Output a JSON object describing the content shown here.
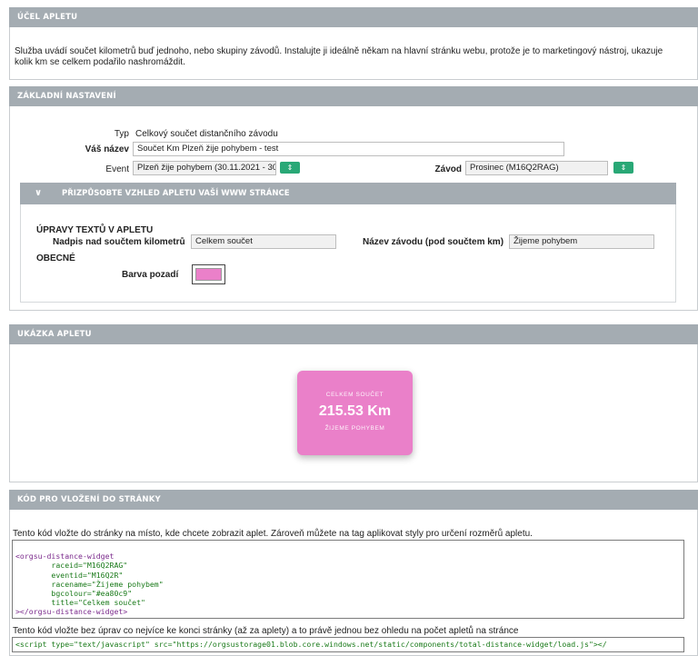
{
  "sections": {
    "ucel": {
      "title": "Účel apletu",
      "description_line1": "Služba uvádí součet kilometrů buď jednoho, nebo skupiny závodů. Instalujte ji ideálně někam na hlavní stránku webu, protože je to marketingový nástroj, ukazuje",
      "description_line2": "kolik km se celkem podařilo nashromáždit."
    },
    "zakladni": {
      "title": "Základní nastavení",
      "typ_label": "Typ",
      "typ_value": "Celkový součet distančního závodu",
      "nazev_label": "Váš název",
      "nazev_value": "Součet Km Plzeň žije pohybem - test",
      "event_label": "Event",
      "event_value": "Plzeň žije pohybem (30.11.2021 - 30.",
      "zavod_label": "Závod",
      "zavod_value": "Prosinec (M16Q2RAG)",
      "customize": {
        "title": "Přizpůsobte vzhled apletu vaší www stránce",
        "texts_heading": "Úpravy textů v apletu",
        "nadpis_label": "Nadpis nad součtem kilometrů",
        "nadpis_value": "Celkem součet",
        "nazev_zavodu_label": "Název závodu (pod součtem km)",
        "nazev_zavodu_value": "Žijeme pohybem",
        "general_heading": "Obecné",
        "barva_label": "Barva pozadí",
        "barva_color": "#ea80c9"
      }
    },
    "ukazka": {
      "title": "Ukázka apletu",
      "widget_title": "Celkem součet",
      "widget_value": "215.53 Km",
      "widget_subtitle": "Žijeme pohybem",
      "widget_bg": "#ea80c9"
    },
    "kod": {
      "title": "Kód pro vložení do stránky",
      "instruction1": "Tento kód vložte do stránky na místo, kde chcete zobrazit aplet. Zároveň můžete na tag aplikovat styly pro určení rozměrů apletu.",
      "code_lines": [
        "<orgsu-distance-widget",
        "        raceid=\"M16Q2RAG\"",
        "        eventid=\"M16Q2R\"",
        "        racename=\"Žijeme pohybem\"",
        "        bgcolour=\"#ea80c9\"",
        "        title=\"Celkem součet\"",
        "></orgsu-distance-widget>"
      ],
      "instruction2": "Tento kód vložte bez úprav co nejvíce ke konci stránky (až za aplety) a to právě jednou bez ohledu na počet apletů na stránce",
      "script_line": "<script type=\"text/javascript\" src=\"https://orgsustorage01.blob.core.windows.net/static/components/total-distance-widget/load.js\"></"
    }
  },
  "icons": {
    "spinner": "up-down-arrows-icon",
    "chevron": "chevron-down-icon"
  }
}
